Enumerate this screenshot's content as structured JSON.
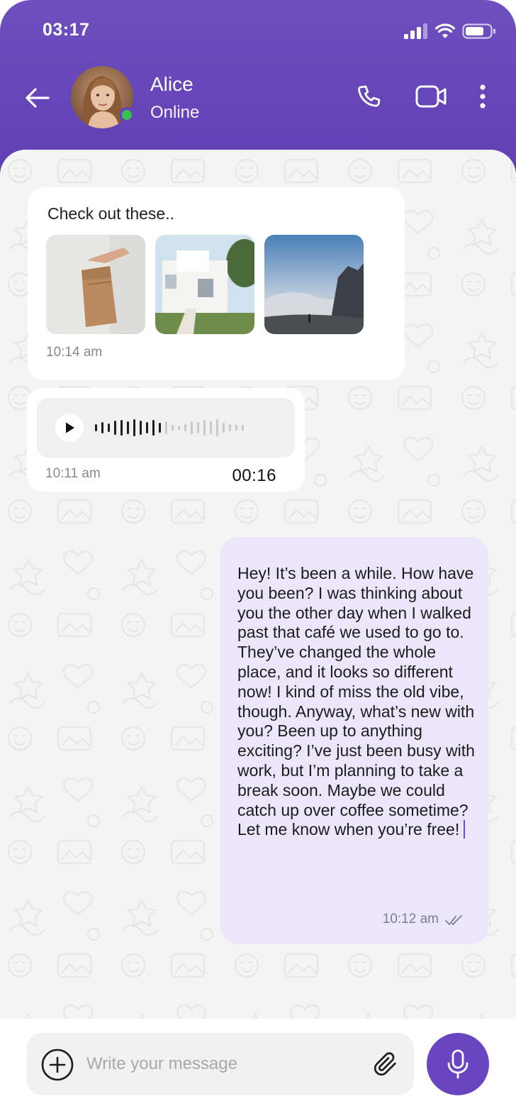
{
  "status_bar": {
    "time": "03:17"
  },
  "header": {
    "contact_name": "Alice",
    "contact_status": "Online",
    "icons": [
      "back-arrow-icon",
      "phone-icon",
      "video-camera-icon",
      "more-vertical-icon"
    ]
  },
  "messages": {
    "images_message": {
      "text": "Check out these..",
      "time": "10:14 am",
      "thumbnails": [
        "paper-bag-photo",
        "white-house-photo",
        "mountain-landscape-photo"
      ]
    },
    "voice_message": {
      "time": "10:11 am",
      "duration": "00:16",
      "progress": 0.45
    },
    "outgoing_message": {
      "text": "Hey! It’s been a while. How have you been? I was thinking about you the other day when I walked past that café we used to go to. They’ve changed the whole place, and it looks so different now! I kind of miss the old vibe, though. Anyway, what’s new with you? Been up to anything exciting? I’ve just been busy with work, but I’m planning to take a break soon. Maybe we could catch up over coffee sometime? Let me know when you’re free!",
      "time": "10:12 am",
      "status_icon": "double-check-icon"
    }
  },
  "composer": {
    "placeholder": "Write your message",
    "icons": [
      "plus-circle-icon",
      "paperclip-icon",
      "microphone-icon"
    ]
  },
  "colors": {
    "header": "#6a4cc0",
    "accent": "#6a45c2",
    "outgoing_bubble": "#ebe6fa",
    "online": "#35c24f"
  }
}
